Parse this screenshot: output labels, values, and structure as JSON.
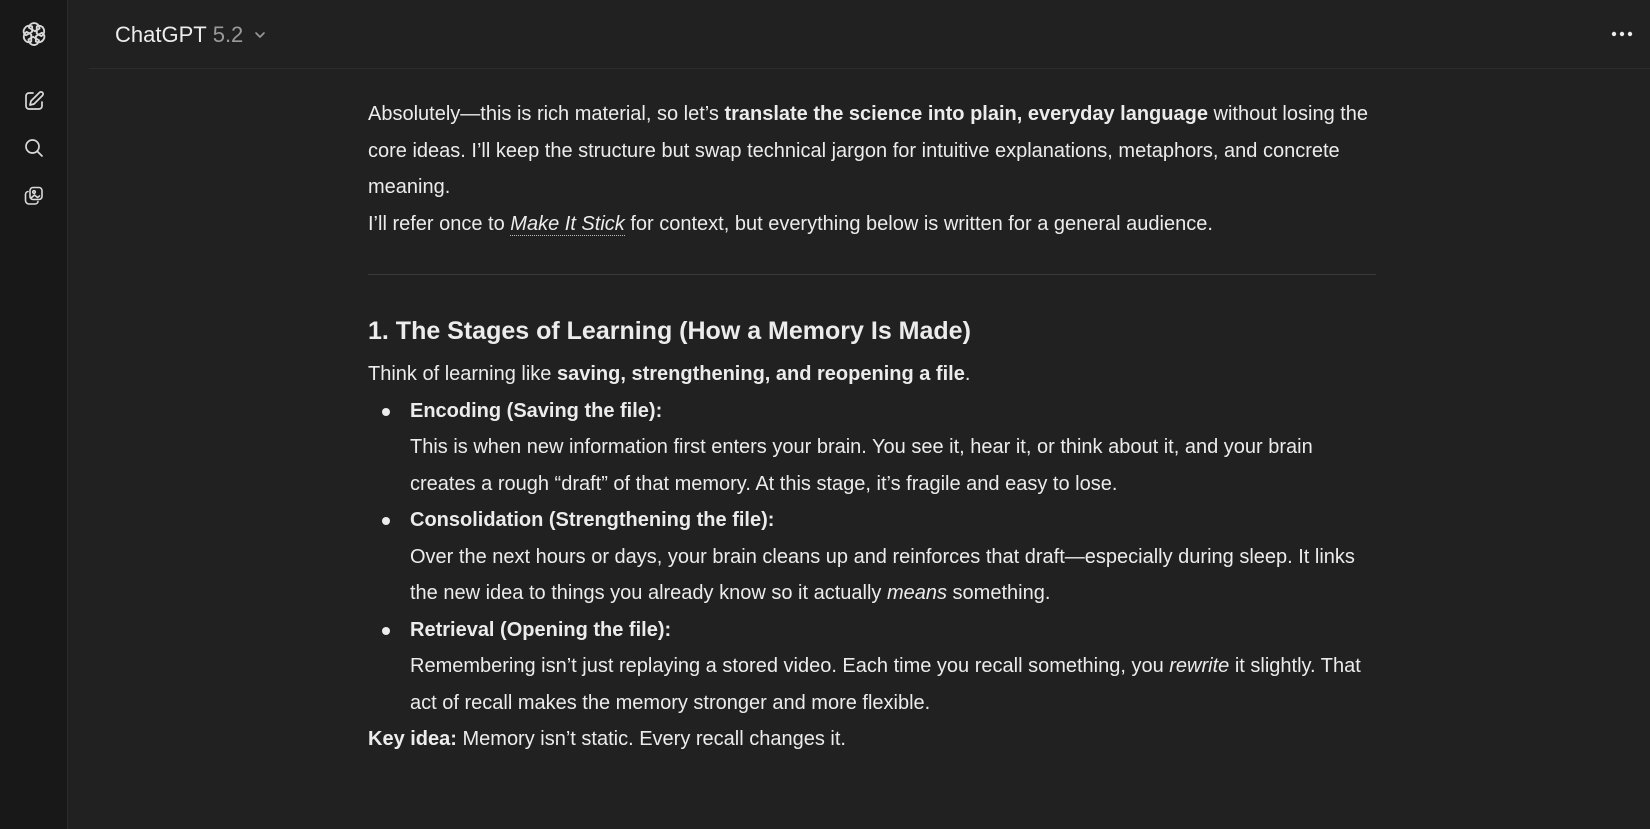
{
  "header": {
    "model_name": "ChatGPT",
    "model_version": "5.2"
  },
  "sidebar": {
    "items": [
      {
        "name": "logo",
        "icon": "openai-logo-icon"
      },
      {
        "name": "new-chat",
        "icon": "compose-icon"
      },
      {
        "name": "search",
        "icon": "search-icon"
      },
      {
        "name": "library",
        "icon": "library-icon"
      }
    ]
  },
  "message": {
    "p1": {
      "a": "Absolutely—this is rich material, so let’s ",
      "b_bold": "translate the science into plain, everyday language",
      "c": " without losing the core ideas. I’ll keep the structure but swap technical jargon for intuitive explanations, metaphors, and concrete meaning."
    },
    "p2": {
      "a": "I’ll refer once to ",
      "link": "Make It Stick",
      "b": " for context, but everything below is written for a general audience."
    },
    "section1": {
      "heading": "1. The Stages of Learning (How a Memory Is Made)",
      "intro_a": "Think of learning like ",
      "intro_bold": "saving, strengthening, and reopening a file",
      "intro_b": ".",
      "items": [
        {
          "term": "Encoding (Saving the file):",
          "desc_a": "This is when new information first enters your brain. You see it, hear it, or think about it, and your brain creates a rough “draft” of that memory. At this stage, it’s fragile and easy to lose.",
          "desc_em": "",
          "desc_b": ""
        },
        {
          "term": "Consolidation (Strengthening the file):",
          "desc_a": "Over the next hours or days, your brain cleans up and reinforces that draft—especially during sleep. It links the new idea to things you already know so it actually ",
          "desc_em": "means",
          "desc_b": " something."
        },
        {
          "term": "Retrieval (Opening the file):",
          "desc_a": "Remembering isn’t just replaying a stored video. Each time you recall something, you ",
          "desc_em": "rewrite",
          "desc_b": " it slightly. That act of recall makes the memory stronger and more flexible."
        }
      ],
      "key_label": "Key idea:",
      "key_text": " Memory isn’t static. Every recall changes it."
    }
  }
}
